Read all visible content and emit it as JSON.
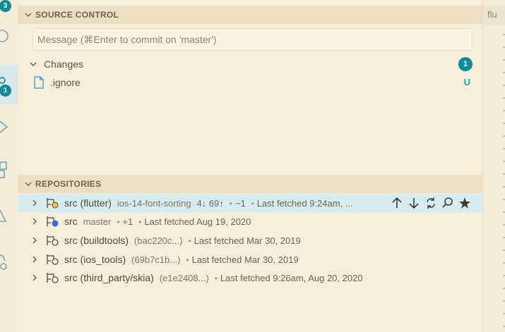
{
  "activity_bar": {
    "explorer_badge": "3",
    "scm_badge": "1"
  },
  "source_control": {
    "header": "SOURCE CONTROL",
    "commit_placeholder": "Message (⌘Enter to commit on 'master')",
    "changes_label": "Changes",
    "changes_count": "1",
    "files": [
      {
        "name": ".ignore",
        "status": "U"
      }
    ]
  },
  "repositories": {
    "header": "REPOSITORIES",
    "items": [
      {
        "name": "src (flutter)",
        "branch": "ios-14-font-sorting",
        "sync": "4↓ 69↑",
        "changes": "~1",
        "fetched": "Last fetched 9:24am, ..."
      },
      {
        "name": "src",
        "branch": "master",
        "changes": "+1",
        "fetched": "Last fetched Aug 19, 2020"
      },
      {
        "name": "src (buildtools)",
        "branch": "(bac220c...)",
        "fetched": "Last fetched Mar 30, 2019"
      },
      {
        "name": "src (ios_tools)",
        "branch": "(69b7c1b...)",
        "fetched": "Last fetched Mar 30, 2019"
      },
      {
        "name": "src (third_party/skia)",
        "branch": "(e1e2408...)",
        "fetched": "Last fetched 9:26am, Aug 20, 2020"
      }
    ],
    "actions": [
      "push-icon",
      "pull-icon",
      "sync-icon",
      "search-icon",
      "star-icon"
    ]
  },
  "editor": {
    "tab_label": "flu"
  },
  "colors": {
    "accent": "#0e8a9a",
    "untracked": "#27a0b5",
    "repo_dot_yellow": "#e8c53a",
    "repo_dot_blue": "#2f6fe0"
  }
}
